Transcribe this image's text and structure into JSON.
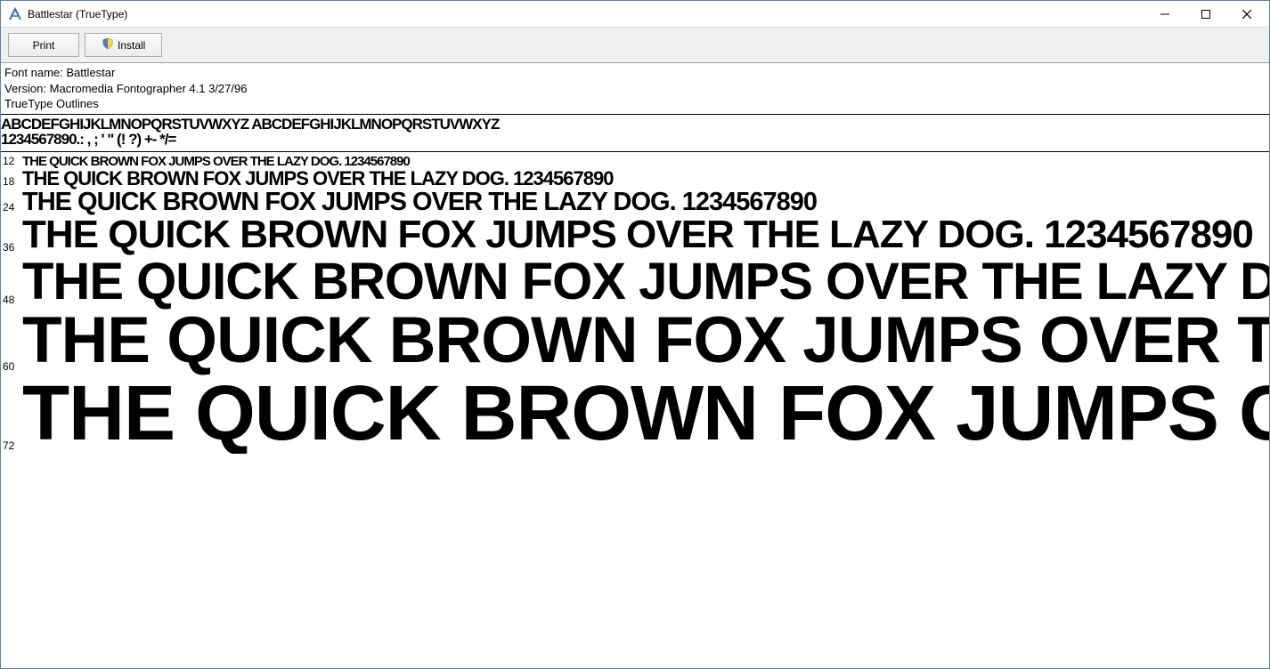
{
  "window": {
    "title": "Battlestar (TrueType)"
  },
  "toolbar": {
    "print_label": "Print",
    "install_label": "Install"
  },
  "info": {
    "font_name_label": "Font name:",
    "font_name_value": "Battlestar",
    "version_label": "Version:",
    "version_value": "Macromedia Fontographer 4.1 3/27/96",
    "outlines": "TrueType Outlines"
  },
  "alphabet": {
    "line1": "ABCDEFGHIJKLMNOPQRSTUVWXYZ  ABCDEFGHIJKLMNOPQRSTUVWXYZ",
    "line2": "1234567890.: , ;    '  \"  (! ?)  +- */="
  },
  "sample_text": "THE QUICK BROWN FOX JUMPS OVER THE LAZY DOG. 1234567890",
  "samples": [
    {
      "size": "12",
      "px": 15
    },
    {
      "size": "18",
      "px": 22
    },
    {
      "size": "24",
      "px": 29
    },
    {
      "size": "36",
      "px": 44
    },
    {
      "size": "48",
      "px": 58
    },
    {
      "size": "60",
      "px": 73
    },
    {
      "size": "72",
      "px": 87
    }
  ]
}
